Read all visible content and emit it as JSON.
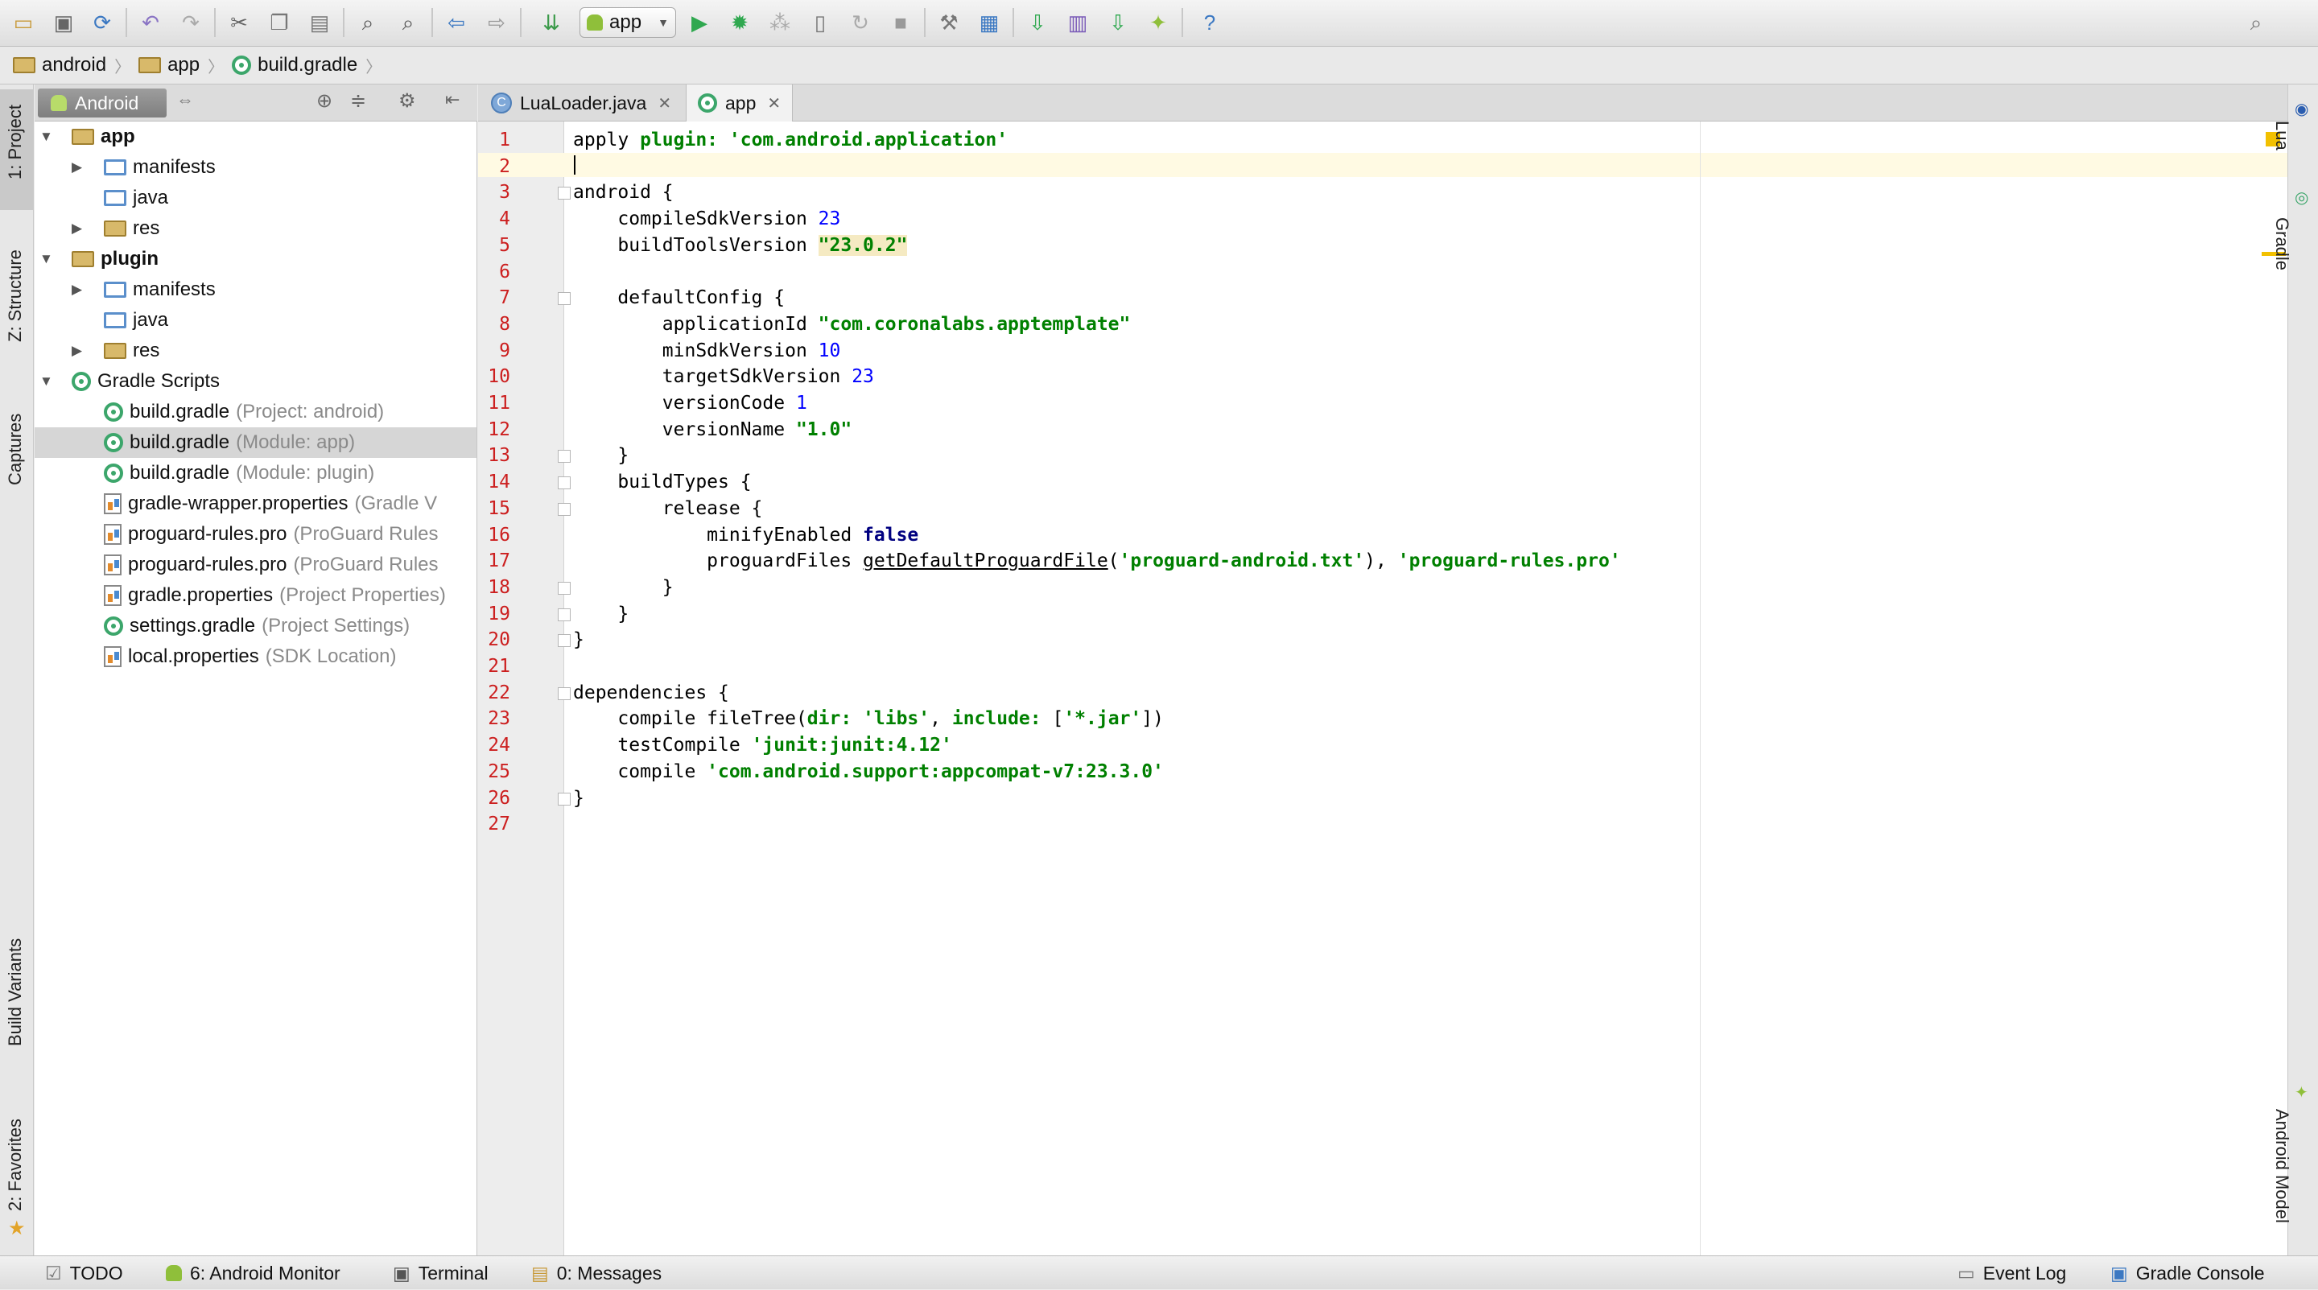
{
  "toolbar": {
    "run_config": "app",
    "icons": [
      "open-folder-icon",
      "save-all-icon",
      "sync-icon",
      "undo-icon",
      "redo-icon",
      "cut-icon",
      "copy-icon",
      "paste-icon",
      "find-icon",
      "replace-icon",
      "back-icon",
      "forward-icon",
      "make-project-icon",
      "run-icon",
      "debug-icon",
      "attach-debugger-icon",
      "apply-changes-icon",
      "rerun-icon",
      "stop-icon",
      "project-structure-icon",
      "sdk-manager-icon",
      "sync-gradle-icon",
      "avd-manager-icon",
      "android-device-monitor-icon",
      "android-icon",
      "help-icon",
      "search-everywhere-icon"
    ]
  },
  "breadcrumbs": [
    {
      "label": "android",
      "icon": "folder-icon"
    },
    {
      "label": "app",
      "icon": "folder-icon"
    },
    {
      "label": "build.gradle",
      "icon": "gradle-icon"
    }
  ],
  "left_stripe": {
    "project_tab": "1: Project",
    "structure_tab": "Z: Structure",
    "captures_tab": "Captures",
    "build_variants_tab": "Build Variants",
    "favorites_tab": "2: Favorites"
  },
  "right_stripe": {
    "lua_tab": "Lua",
    "gradle_tab": "Gradle",
    "android_model_tab": "Android Model"
  },
  "project_panel": {
    "view_mode": "Android",
    "tree": [
      {
        "label": "app",
        "hint": "",
        "bold": true,
        "level": 0,
        "expanded": true,
        "icon": "module-folder-icon"
      },
      {
        "label": "manifests",
        "hint": "",
        "level": 1,
        "icon": "folder-icon"
      },
      {
        "label": "java",
        "hint": "",
        "level": 1,
        "icon": "folder-icon"
      },
      {
        "label": "res",
        "hint": "",
        "level": 1,
        "icon": "res-folder-icon"
      },
      {
        "label": "plugin",
        "hint": "",
        "bold": true,
        "level": 0,
        "expanded": true,
        "icon": "module-folder-icon"
      },
      {
        "label": "manifests",
        "hint": "",
        "level": 1,
        "icon": "folder-icon"
      },
      {
        "label": "java",
        "hint": "",
        "level": 1,
        "icon": "folder-icon"
      },
      {
        "label": "res",
        "hint": "",
        "level": 1,
        "icon": "res-folder-icon"
      },
      {
        "label": "Gradle Scripts",
        "hint": "",
        "level": 0,
        "expanded": true,
        "icon": "gradle-icon"
      },
      {
        "label": "build.gradle",
        "hint": "(Project: android)",
        "level": 1,
        "icon": "gradle-icon"
      },
      {
        "label": "build.gradle",
        "hint": "(Module: app)",
        "level": 1,
        "icon": "gradle-icon",
        "selected": true
      },
      {
        "label": "build.gradle",
        "hint": "(Module: plugin)",
        "level": 1,
        "icon": "gradle-icon"
      },
      {
        "label": "gradle-wrapper.properties",
        "hint": "(Gradle V",
        "level": 1,
        "icon": "properties-file-icon"
      },
      {
        "label": "proguard-rules.pro",
        "hint": "(ProGuard Rules",
        "level": 1,
        "icon": "text-file-icon"
      },
      {
        "label": "proguard-rules.pro",
        "hint": "(ProGuard Rules",
        "level": 1,
        "icon": "text-file-icon"
      },
      {
        "label": "gradle.properties",
        "hint": "(Project Properties)",
        "level": 1,
        "icon": "properties-file-icon"
      },
      {
        "label": "settings.gradle",
        "hint": "(Project Settings)",
        "level": 1,
        "icon": "gradle-icon"
      },
      {
        "label": "local.properties",
        "hint": "(SDK Location)",
        "level": 1,
        "icon": "properties-file-icon"
      }
    ]
  },
  "editor_tabs": [
    {
      "label": "LuaLoader.java",
      "icon": "java-class-icon",
      "active": false
    },
    {
      "label": "app",
      "icon": "gradle-icon",
      "active": true
    }
  ],
  "editor": {
    "lines": [
      [
        {
          "t": "apply "
        },
        {
          "t": "plugin:",
          "c": "str"
        },
        {
          "t": " "
        },
        {
          "t": "'com.android.application'",
          "c": "str"
        }
      ],
      [],
      [
        {
          "t": "android {"
        }
      ],
      [
        {
          "t": "    compileSdkVersion "
        },
        {
          "t": "23",
          "c": "num"
        }
      ],
      [
        {
          "t": "    buildToolsVersion "
        },
        {
          "t": "\"23.0.2\"",
          "c": "hl"
        }
      ],
      [],
      [
        {
          "t": "    defaultConfig {"
        }
      ],
      [
        {
          "t": "        applicationId "
        },
        {
          "t": "\"com.coronalabs.apptemplate\"",
          "c": "str"
        }
      ],
      [
        {
          "t": "        minSdkVersion "
        },
        {
          "t": "10",
          "c": "num"
        }
      ],
      [
        {
          "t": "        targetSdkVersion "
        },
        {
          "t": "23",
          "c": "num"
        }
      ],
      [
        {
          "t": "        versionCode "
        },
        {
          "t": "1",
          "c": "num"
        }
      ],
      [
        {
          "t": "        versionName "
        },
        {
          "t": "\"1.0\"",
          "c": "str"
        }
      ],
      [
        {
          "t": "    }"
        }
      ],
      [
        {
          "t": "    buildTypes {"
        }
      ],
      [
        {
          "t": "        release {"
        }
      ],
      [
        {
          "t": "            minifyEnabled "
        },
        {
          "t": "false",
          "c": "kw"
        }
      ],
      [
        {
          "t": "            proguardFiles "
        },
        {
          "t": "getDefaultProguardFile",
          "c": "u"
        },
        {
          "t": "("
        },
        {
          "t": "'proguard-android.txt'",
          "c": "str"
        },
        {
          "t": "), "
        },
        {
          "t": "'proguard-rules.pro'",
          "c": "str"
        }
      ],
      [
        {
          "t": "        }"
        }
      ],
      [
        {
          "t": "    }"
        }
      ],
      [
        {
          "t": "}"
        }
      ],
      [],
      [
        {
          "t": "dependencies {"
        }
      ],
      [
        {
          "t": "    compile fileTree("
        },
        {
          "t": "dir:",
          "c": "str"
        },
        {
          "t": " "
        },
        {
          "t": "'libs'",
          "c": "str"
        },
        {
          "t": ", "
        },
        {
          "t": "include:",
          "c": "str"
        },
        {
          "t": " ["
        },
        {
          "t": "'*.jar'",
          "c": "str"
        },
        {
          "t": "])"
        }
      ],
      [
        {
          "t": "    testCompile "
        },
        {
          "t": "'junit:junit:4.12'",
          "c": "str"
        }
      ],
      [
        {
          "t": "    compile "
        },
        {
          "t": "'com.android.support:appcompat-v7:23.3.0'",
          "c": "str"
        }
      ],
      [
        {
          "t": "}"
        }
      ],
      []
    ]
  },
  "status_bar": {
    "todo": "TODO",
    "android_monitor": "6: Android Monitor",
    "terminal": "Terminal",
    "messages": "0: Messages",
    "event_log": "Event Log",
    "gradle_console": "Gradle Console"
  }
}
